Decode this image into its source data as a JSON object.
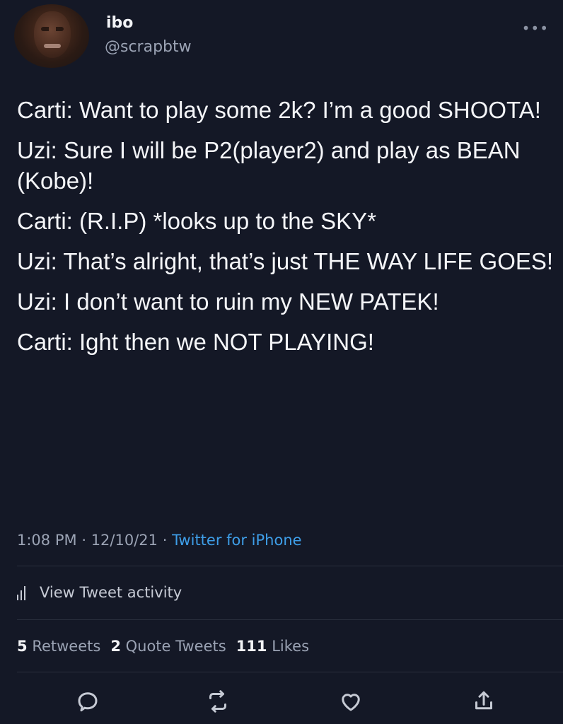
{
  "author": {
    "name": "ibo",
    "handle": "@scrapbtw"
  },
  "menu": {
    "more_icon": "more-dots-icon",
    "more_label": "•••"
  },
  "tweet": {
    "lines": [
      "Carti: Want to play some 2k? I’m a good SHOOTA!",
      "Uzi: Sure I will be P2(player2) and play as BEAN (Kobe)!",
      "Carti: (R.I.P) *looks up to the SKY*",
      "Uzi: That’s alright, that’s just THE WAY LIFE GOES!",
      "Uzi: I don’t want to ruin my NEW PATEK!",
      "Carti: Ight then we NOT PLAYING!"
    ],
    "time": "1:08 PM",
    "date": "12/10/21",
    "separator": "·",
    "source": "Twitter for iPhone"
  },
  "activity": {
    "label": "View Tweet activity",
    "icon": "analytics-bars-icon"
  },
  "stats": {
    "retweets_count": "5",
    "retweets_label": "Retweets",
    "quotes_count": "2",
    "quotes_label": "Quote Tweets",
    "likes_count": "111",
    "likes_label": "Likes"
  },
  "actions": {
    "icons": [
      "reply-icon",
      "retweet-icon",
      "like-icon",
      "share-icon"
    ]
  },
  "colors": {
    "background": "#141826",
    "text": "#f4f5f8",
    "muted": "#9ba3b4",
    "link": "#3e9ee8"
  }
}
